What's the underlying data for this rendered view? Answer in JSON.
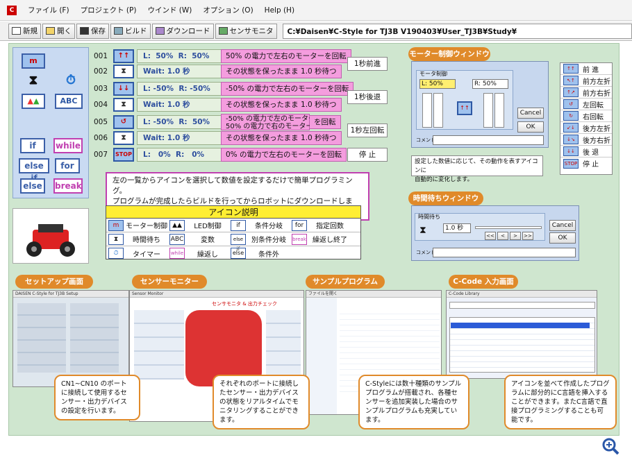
{
  "menu": [
    "ファイル (F)",
    "プロジェクト (P)",
    "ウインド (W)",
    "オプション (O)",
    "Help (H)"
  ],
  "toolbar": {
    "buttons": [
      "新規",
      "開く",
      "保存",
      "ビルド",
      "ダウンロード",
      "センサモニタ"
    ],
    "path": "C:¥Daisen¥C-Style for TJ3B V190403¥User_TJ3B¥Study¥"
  },
  "palette": {
    "icons": [
      "m",
      "⧗",
      "⏱",
      "ABC"
    ],
    "keywords": [
      "if",
      "while",
      "else if",
      "for",
      "else",
      "break"
    ]
  },
  "program": [
    {
      "num": "001",
      "icon": "↑↑",
      "value": "L:  50%  R:  50%",
      "desc": "50% の電力で左右のモーターを回転"
    },
    {
      "num": "002",
      "icon": "⧗",
      "value": "Wait: 1.0 秒",
      "desc": "その状態を保ったまま 1.0 秒待つ"
    },
    {
      "num": "003",
      "icon": "↓↓",
      "value": "L: -50%  R: -50%",
      "desc": "-50% の電力で左右のモーターを回転"
    },
    {
      "num": "004",
      "icon": "⧗",
      "value": "Wait: 1.0 秒",
      "desc": "その状態を保ったまま 1.0 秒待つ"
    },
    {
      "num": "005",
      "icon": "↺",
      "value": "L: -50%  R:  50%",
      "desc1": "-50% の電力で左のモーター",
      "desc2": "50% の電力で右のモーター",
      "suffix": "を回転"
    },
    {
      "num": "006",
      "icon": "⧗",
      "value": "Wait: 1.0 秒",
      "desc": "その状態を保ったまま 1.0 秒待つ"
    },
    {
      "num": "007",
      "icon": "STOP",
      "value": "L:   0%  R:   0%",
      "desc": "0% の電力で左右のモーターを回転"
    }
  ],
  "labels": {
    "forward": "1秒前進",
    "backward": "1秒後退",
    "left_turn": "1秒左回転",
    "stop": "停 止"
  },
  "note_main": {
    "line1": "左の一覧からアイコンを選択して数値を設定するだけで簡単プログラミング。",
    "line2": "プログラムが完成したらビルドを行ってからロボットにダウンロードします。"
  },
  "legend": {
    "title": "アイコン説明",
    "rows": [
      [
        {
          "icon": "m",
          "text": "モーター制御"
        },
        {
          "icon": "▲▲",
          "text": "LED制御"
        },
        {
          "icon": "if",
          "text": "条件分岐"
        },
        {
          "icon": "for",
          "text": "指定回数"
        }
      ],
      [
        {
          "icon": "⧗",
          "text": "時間待ち"
        },
        {
          "icon": "ABC",
          "text": "変数"
        },
        {
          "icon": "else if",
          "text": "別条件分岐"
        },
        {
          "icon": "break",
          "text": "繰返し終了"
        }
      ],
      [
        {
          "icon": "⏱",
          "text": "タイマー"
        },
        {
          "icon": "while",
          "text": "繰返し"
        },
        {
          "icon": "else",
          "text": "条件外"
        }
      ]
    ]
  },
  "motor_window": {
    "tag": "モーター制御ウィンドウ",
    "group_label": "モータ制御",
    "left_value": "L: 50%",
    "right_value": "R: 50%",
    "cancel": "Cancel",
    "ok": "OK",
    "comment_label": "コメント",
    "note1": "設定した数値に応じて、その動作を表すアイコンに",
    "note2": "自動的に変化します。"
  },
  "timer_window": {
    "tag": "時間待ちウィンドウ",
    "group_label": "時間待ち",
    "value": "1.0 秒",
    "cancel": "Cancel",
    "ok": "OK",
    "comment_label": "コメント",
    "arrows": [
      "<<",
      "<",
      ">",
      ">>"
    ]
  },
  "directions": [
    "前 進",
    "前方左折",
    "前方右折",
    "左回転",
    "右回転",
    "後方左折",
    "後方右折",
    "後 退",
    "停 止"
  ],
  "sections": {
    "setup": {
      "tag": "セットアップ画面",
      "note": "CN1~CN10 のポートに接続して使用するセンサー・出力デバイスの設定を行います。"
    },
    "sensor": {
      "tag": "センサーモニター",
      "heading": "センサモニタ & 出力チェック",
      "note": "それぞれのポートに接続したセンサー・出力デバイスの状態をリアルタイムでモニタリングすることができます。"
    },
    "sample": {
      "tag": "サンプルプログラム",
      "note": "C-Styleには数十種類のサンプルプログラムが搭載され、各種センサーを追加実装した場合のサンプルプログラムも充実しています。"
    },
    "ccode": {
      "tag": "C-Code 入力画面",
      "note": "アイコンを並べて作成したプログラムに部分的にC言語を挿入することができます。またC言語で直接プログラミングすることも可能です。"
    }
  },
  "colors": {
    "accent_pink": "#f49dde",
    "accent_orange": "#e08a2a",
    "bg_green": "#cfe6cf",
    "icon_blue": "#9fc2ee"
  }
}
